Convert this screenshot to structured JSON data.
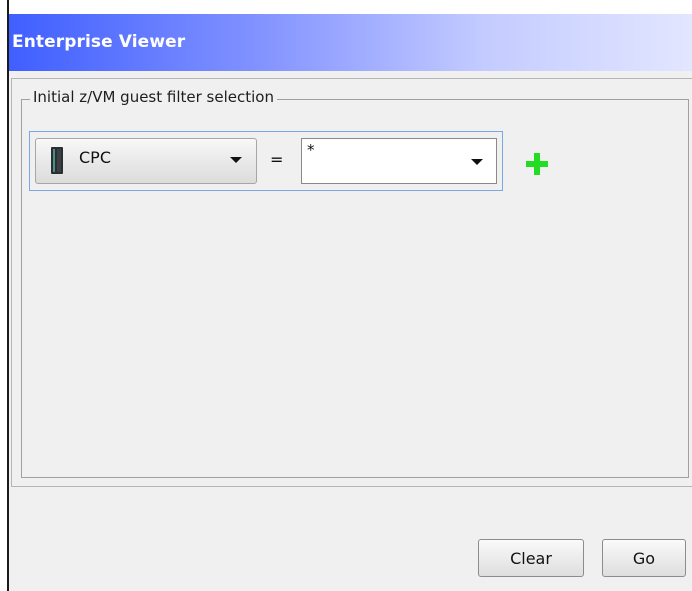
{
  "window": {
    "title": "Enterprise Viewer"
  },
  "filter_group": {
    "legend": "Initial z/VM guest filter selection",
    "rows": [
      {
        "attribute": "CPC",
        "attribute_icon": "server-icon",
        "operator": "=",
        "value": "*"
      }
    ],
    "add_icon": "plus-icon",
    "add_icon_color": "#22dd22"
  },
  "buttons": {
    "clear_label": "Clear",
    "go_label": "Go"
  },
  "colors": {
    "title_gradient_start": "#3f5fff",
    "title_gradient_end": "#e2e6ff",
    "title_text": "#ffffff",
    "row_highlight_border": "#7aa7e8",
    "background": "#f0f0f0"
  }
}
